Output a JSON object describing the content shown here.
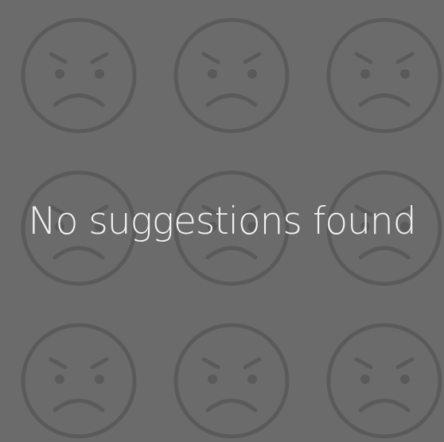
{
  "empty_state": {
    "message": "No suggestions found",
    "icon": "sad-face-icon",
    "icon_rows": 3,
    "icon_cols": 3
  },
  "colors": {
    "background": "#6b6b6b",
    "icon_stroke": "#5a5a5a",
    "message_text": "#f2f2f2"
  }
}
